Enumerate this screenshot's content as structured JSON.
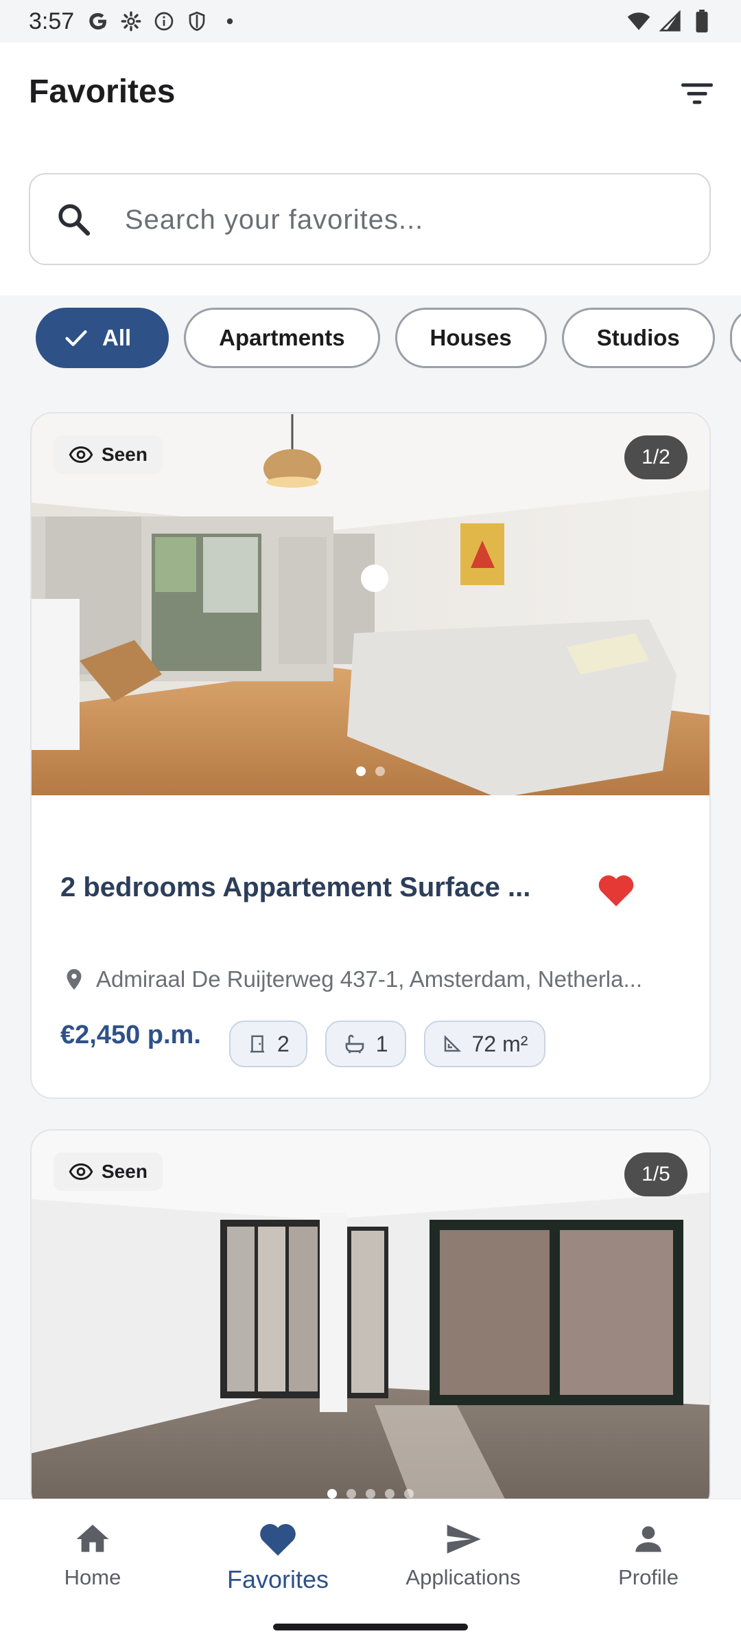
{
  "status_bar": {
    "time": "3:57",
    "left_icons": [
      "google-icon",
      "settings-icon",
      "info-icon",
      "shield-icon",
      "dot-icon"
    ],
    "right_icons": [
      "wifi-icon",
      "signal-icon",
      "battery-icon"
    ]
  },
  "header": {
    "title": "Favorites",
    "filter_icon": "filter-list-icon"
  },
  "search": {
    "placeholder": "Search your favorites...",
    "value": ""
  },
  "filters": {
    "chips": [
      {
        "label": "All",
        "selected": true
      },
      {
        "label": "Apartments",
        "selected": false
      },
      {
        "label": "Houses",
        "selected": false
      },
      {
        "label": "Studios",
        "selected": false
      }
    ]
  },
  "listings": [
    {
      "seen_label": "Seen",
      "image_counter": "1/2",
      "image_count": 2,
      "active_image": 1,
      "title": "2 bedrooms Appartement Surface ...",
      "favorited": true,
      "address": "Admiraal De Ruijterweg 437-1, Amsterdam, Netherla...",
      "price": "€2,450 p.m.",
      "bedrooms": "2",
      "bathrooms": "1",
      "area": "72 m²"
    },
    {
      "seen_label": "Seen",
      "image_counter": "1/5",
      "image_count": 5,
      "active_image": 1
    }
  ],
  "bottom_nav": {
    "items": [
      {
        "label": "Home",
        "icon": "home-icon",
        "active": false
      },
      {
        "label": "Favorites",
        "icon": "heart-icon",
        "active": true
      },
      {
        "label": "Applications",
        "icon": "send-icon",
        "active": false
      },
      {
        "label": "Profile",
        "icon": "person-icon",
        "active": false
      }
    ]
  },
  "colors": {
    "accent": "#2e5188",
    "favorite_red": "#e53935",
    "background": "#f4f5f7"
  }
}
